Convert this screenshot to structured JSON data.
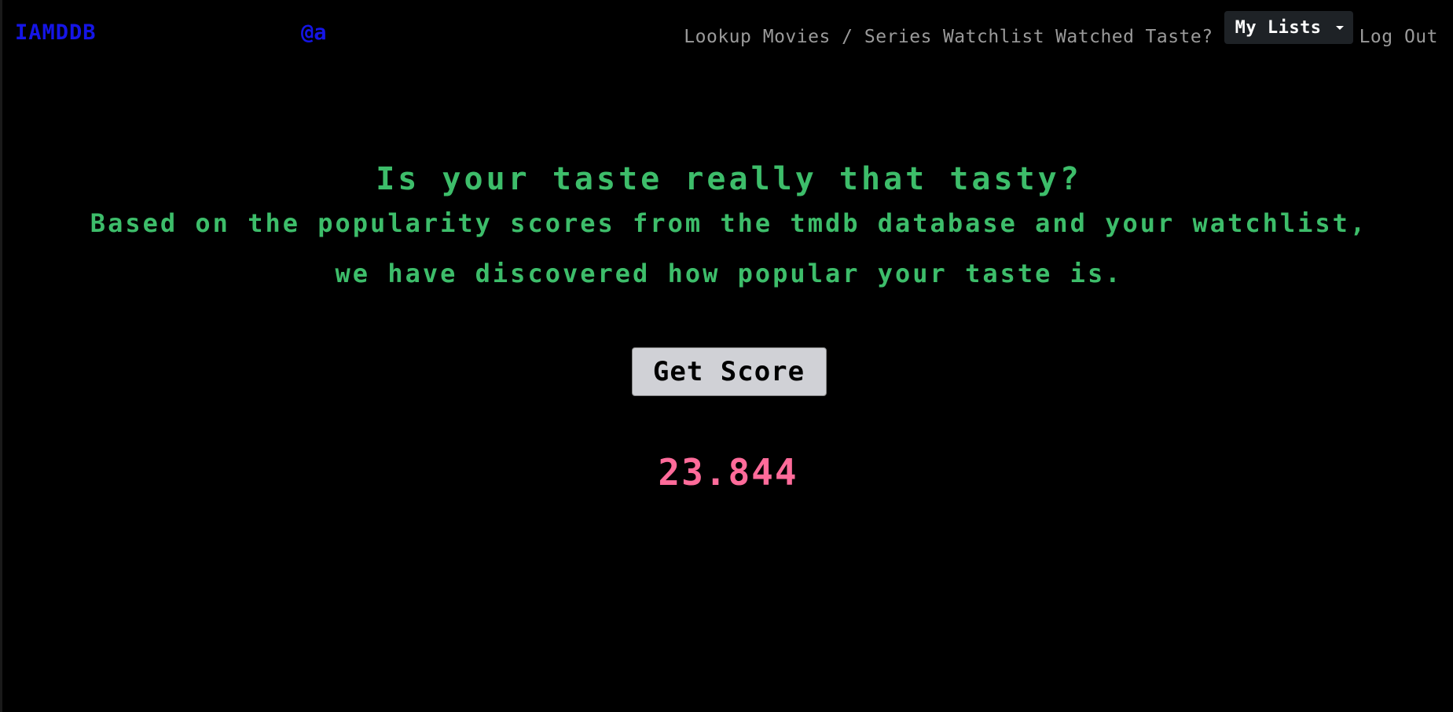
{
  "navbar": {
    "brand": "IAMDDB",
    "user_handle": "@a",
    "links": {
      "lookup": "Lookup Movies / Series",
      "watchlist": "Watchlist",
      "watched": "Watched",
      "taste": "Taste?"
    },
    "dropdown": {
      "label": "My Lists",
      "icon": "chevron-down-icon"
    },
    "logout": "Log Out"
  },
  "main": {
    "heading": "Is your taste really that tasty?",
    "description": "Based on the popularity scores from the tmdb database and your watchlist, we have discovered how popular your taste is.",
    "button_label": "Get Score",
    "score": "23.844"
  },
  "colors": {
    "background": "#000000",
    "brand": "#1515e6",
    "nav_text": "#9a9a9a",
    "heading": "#3dbd6a",
    "score": "#ff6b9a",
    "button_bg": "#d0d1d6"
  }
}
